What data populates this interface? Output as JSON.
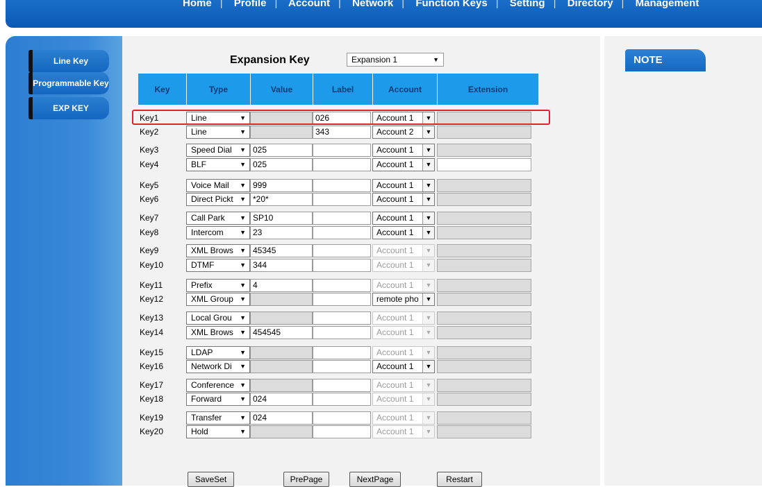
{
  "nav": [
    "Home",
    "Profile",
    "Account",
    "Network",
    "Function Keys",
    "Setting",
    "Directory",
    "Management"
  ],
  "sidebar": [
    "Line Key",
    "Programmable Key",
    "EXP KEY"
  ],
  "page_title": "Expansion Key",
  "expansion_select": "Expansion 1",
  "headers": [
    "Key",
    "Type",
    "Value",
    "Label",
    "Account",
    "Extension"
  ],
  "rows": [
    {
      "key": "Key1",
      "type": "Line",
      "value": "",
      "label": "026",
      "account": "Account 1",
      "value_enabled": false,
      "account_enabled": true,
      "ext_enabled": false
    },
    {
      "key": "Key2",
      "type": "Line",
      "value": "",
      "label": "343",
      "account": "Account 2",
      "value_enabled": false,
      "account_enabled": true,
      "ext_enabled": false
    },
    {
      "key": "Key3",
      "type": "Speed Dial",
      "value": "025",
      "label": "",
      "account": "Account 1",
      "value_enabled": true,
      "account_enabled": true,
      "ext_enabled": false
    },
    {
      "key": "Key4",
      "type": "BLF",
      "value": "025",
      "label": "",
      "account": "Account 1",
      "value_enabled": true,
      "account_enabled": true,
      "ext_enabled": true
    },
    {
      "key": "Key5",
      "type": "Voice Mail",
      "value": "999",
      "label": "",
      "account": "Account 1",
      "value_enabled": true,
      "account_enabled": true,
      "ext_enabled": false
    },
    {
      "key": "Key6",
      "type": "Direct Pickt",
      "value": "*20*",
      "label": "",
      "account": "Account 1",
      "value_enabled": true,
      "account_enabled": true,
      "ext_enabled": false
    },
    {
      "key": "Key7",
      "type": "Call Park",
      "value": "SP10",
      "label": "",
      "account": "Account 1",
      "value_enabled": true,
      "account_enabled": true,
      "ext_enabled": false
    },
    {
      "key": "Key8",
      "type": "Intercom",
      "value": "23",
      "label": "",
      "account": "Account 1",
      "value_enabled": true,
      "account_enabled": true,
      "ext_enabled": false
    },
    {
      "key": "Key9",
      "type": "XML Brows",
      "value": "45345",
      "label": "",
      "account": "Account 1",
      "value_enabled": true,
      "account_enabled": false,
      "ext_enabled": false
    },
    {
      "key": "Key10",
      "type": "DTMF",
      "value": "344",
      "label": "",
      "account": "Account 1",
      "value_enabled": true,
      "account_enabled": false,
      "ext_enabled": false
    },
    {
      "key": "Key11",
      "type": "Prefix",
      "value": "4",
      "label": "",
      "account": "Account 1",
      "value_enabled": true,
      "account_enabled": false,
      "ext_enabled": false
    },
    {
      "key": "Key12",
      "type": "XML Group",
      "value": "",
      "label": "",
      "account": "remote pho",
      "value_enabled": false,
      "account_enabled": true,
      "ext_enabled": false
    },
    {
      "key": "Key13",
      "type": "Local Grou",
      "value": "",
      "label": "",
      "account": "Account 1",
      "value_enabled": false,
      "account_enabled": false,
      "ext_enabled": false
    },
    {
      "key": "Key14",
      "type": "XML Brows",
      "value": "454545",
      "label": "",
      "account": "Account 1",
      "value_enabled": true,
      "account_enabled": false,
      "ext_enabled": false
    },
    {
      "key": "Key15",
      "type": "LDAP",
      "value": "",
      "label": "",
      "account": "Account 1",
      "value_enabled": false,
      "account_enabled": false,
      "ext_enabled": false
    },
    {
      "key": "Key16",
      "type": "Network Di",
      "value": "",
      "label": "",
      "account": "Account 1",
      "value_enabled": false,
      "account_enabled": true,
      "ext_enabled": false
    },
    {
      "key": "Key17",
      "type": "Conference",
      "value": "",
      "label": "",
      "account": "Account 1",
      "value_enabled": false,
      "account_enabled": false,
      "ext_enabled": false
    },
    {
      "key": "Key18",
      "type": "Forward",
      "value": "024",
      "label": "",
      "account": "Account 1",
      "value_enabled": true,
      "account_enabled": false,
      "ext_enabled": false
    },
    {
      "key": "Key19",
      "type": "Transfer",
      "value": "024",
      "label": "",
      "account": "Account 1",
      "value_enabled": true,
      "account_enabled": false,
      "ext_enabled": false
    },
    {
      "key": "Key20",
      "type": "Hold",
      "value": "",
      "label": "",
      "account": "Account 1",
      "value_enabled": false,
      "account_enabled": false,
      "ext_enabled": false
    }
  ],
  "buttons": [
    "SaveSet",
    "PrePage",
    "NextPage",
    "Restart"
  ],
  "note_title": "NOTE",
  "colors": {
    "header": "#1e9aea",
    "nav": "#0a59b5",
    "highlight": "#e3212c"
  }
}
